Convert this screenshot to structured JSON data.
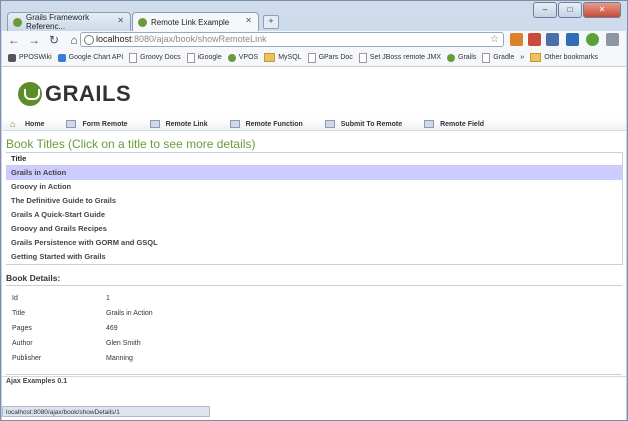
{
  "browser": {
    "tabs": [
      {
        "label": "Grails Framework Referenc..."
      },
      {
        "label": "Remote Link Example"
      }
    ],
    "new_tab": "+",
    "window_buttons": [
      "–",
      "□",
      "✕"
    ],
    "address": {
      "host": "localhost",
      "path": ":8080/ajax/book/showRemoteLink"
    },
    "bookmarks": [
      "PPOSWiki",
      "Google Chart API",
      "Groovy Docs",
      "iGoogle",
      "VPOS",
      "MySQL",
      "GPars Doc",
      "Set JBoss remote JMX",
      "Grails",
      "Gradle",
      "Other bookmarks"
    ],
    "bookmarks_overflow": "»",
    "status_url": "localhost:8080/ajax/book/showDetails/1"
  },
  "page": {
    "logo_text": "GRAILS",
    "nav": [
      "Home",
      "Form Remote",
      "Remote Link",
      "Remote Function",
      "Submit To Remote",
      "Remote Field"
    ],
    "heading": "Book Titles (Click on a title to see more details)",
    "titles_header": "Title",
    "titles": [
      "Grails in Action",
      "Groovy in Action",
      "The Definitive Guide to Grails",
      "Grails A Quick-Start Guide",
      "Groovy and Grails Recipes",
      "Grails Persistence with GORM and GSQL",
      "Getting Started with Grails"
    ],
    "selected_title_index": 0,
    "details_heading": "Book Details:",
    "details": [
      {
        "key": "Id",
        "value": "1"
      },
      {
        "key": "Title",
        "value": "Grails in Action"
      },
      {
        "key": "Pages",
        "value": "469"
      },
      {
        "key": "Author",
        "value": "Glen Smith"
      },
      {
        "key": "Publisher",
        "value": "Manning"
      }
    ],
    "footer": "Ajax Examples 0.1"
  },
  "colors": {
    "selected_row": "#ccccff",
    "heading_green": "#6a9b3a"
  }
}
